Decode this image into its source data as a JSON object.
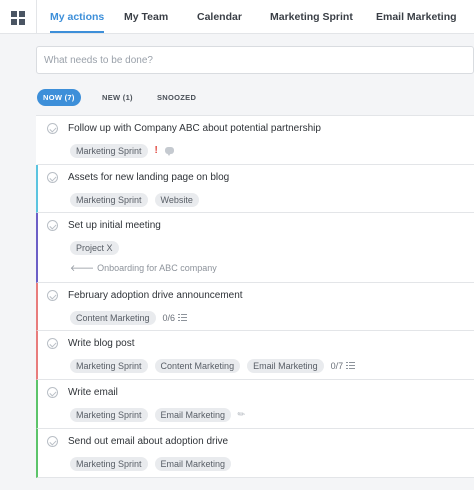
{
  "nav": {
    "tabs": [
      {
        "label": "My actions"
      },
      {
        "label": "My Team"
      },
      {
        "label": "Calendar"
      },
      {
        "label": "Marketing Sprint"
      },
      {
        "label": "Email Marketing"
      }
    ],
    "active_tab": "My actions"
  },
  "add_task": {
    "placeholder": "What needs to be done?"
  },
  "filters": {
    "now": "NOW (7)",
    "new": "NEW (1)",
    "snoozed": "SNOOZED"
  },
  "tasks": [
    {
      "title": "Follow up with Company ABC about potential partnership",
      "tags": [
        "Marketing Sprint"
      ],
      "priority_mark": "!",
      "has_comment": true,
      "bar_color": ""
    },
    {
      "title": "Assets for new landing page on blog",
      "tags": [
        "Marketing Sprint",
        "Website"
      ],
      "bar_color": "#5bc4e0"
    },
    {
      "title": "Set up initial meeting",
      "tags": [
        "Project X"
      ],
      "parent": "Onboarding for ABC company",
      "bar_color": "#6c5fc7"
    },
    {
      "title": "February adoption drive announcement",
      "tags": [
        "Content Marketing"
      ],
      "checklist": "0/6",
      "bar_color": "#e87c7c"
    },
    {
      "title": "Write blog post",
      "tags": [
        "Marketing Sprint",
        "Content Marketing",
        "Email Marketing"
      ],
      "checklist": "0/7",
      "bar_color": "#e87c7c"
    },
    {
      "title": "Write email",
      "tags": [
        "Marketing Sprint",
        "Email Marketing"
      ],
      "has_attachment": true,
      "bar_color": "#5cc46a"
    },
    {
      "title": "Send out email about adoption drive",
      "tags": [
        "Marketing Sprint",
        "Email Marketing"
      ],
      "bar_color": "#5cc46a"
    }
  ],
  "colors": {
    "accent": "#3d8fd9",
    "priority": "#e0453d"
  },
  "icons": {
    "apps": "grid-icon",
    "check": "circle-check-icon",
    "comment": "comment-icon",
    "checklist": "list-icon",
    "attachment": "paperclip-icon",
    "parent": "arrow-left-icon"
  }
}
